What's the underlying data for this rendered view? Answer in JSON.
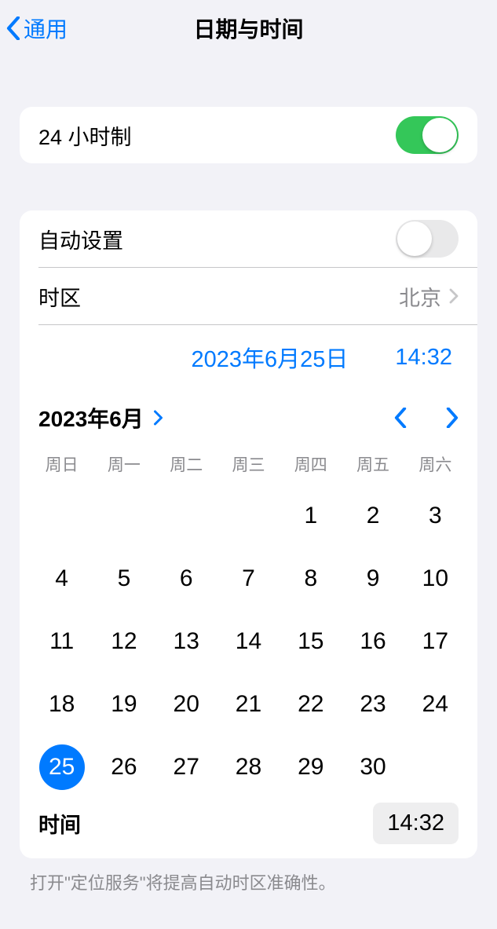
{
  "header": {
    "back_label": "通用",
    "title": "日期与时间"
  },
  "settings": {
    "twentyfour_label": "24 小时制",
    "auto_label": "自动设置",
    "timezone_label": "时区",
    "timezone_value": "北京"
  },
  "datetime": {
    "date_display": "2023年6月25日",
    "time_display": "14:32"
  },
  "calendar": {
    "month_label": "2023年6月",
    "weekdays": [
      "周日",
      "周一",
      "周二",
      "周三",
      "周四",
      "周五",
      "周六"
    ],
    "leading_blanks": 4,
    "days_in_month": 30,
    "selected_day": 25,
    "time_label": "时间",
    "time_value": "14:32"
  },
  "footnote": "打开\"定位服务\"将提高自动时区准确性。"
}
